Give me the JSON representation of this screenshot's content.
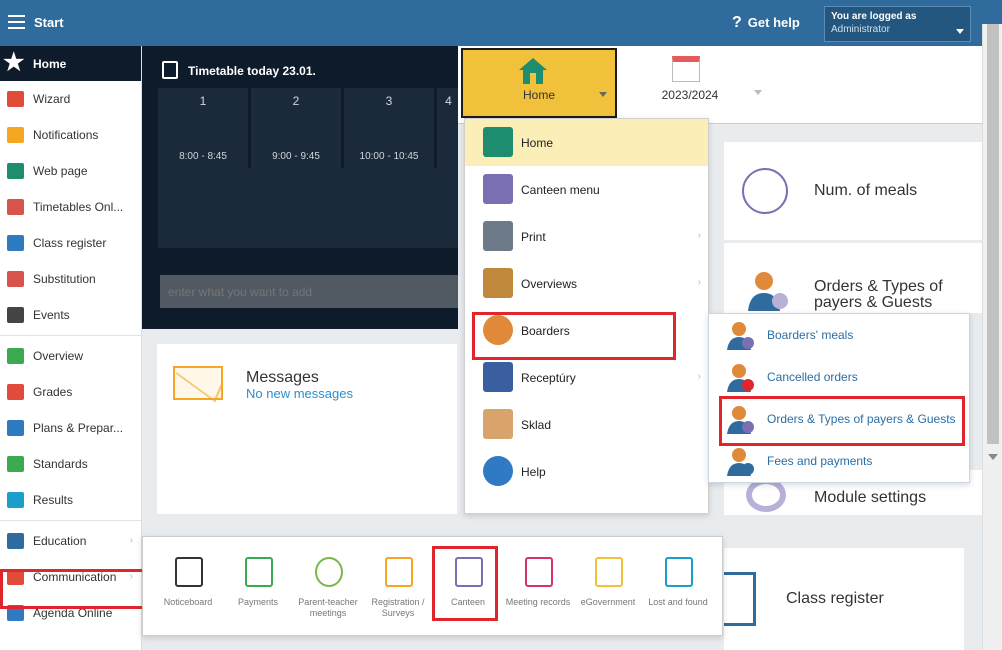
{
  "topbar": {
    "start_label": "Start",
    "help_label": "Get help",
    "login_line1": "You are logged as",
    "login_line2": "Administrator"
  },
  "sidebar": {
    "home_label": "Home",
    "items": [
      {
        "label": "Wizard",
        "icon": "wand-icon",
        "color": "#e04b3a"
      },
      {
        "label": "Notifications",
        "icon": "mail-icon",
        "color": "#f5a623"
      },
      {
        "label": "Web page",
        "icon": "house-icon",
        "color": "#1e8c6e"
      },
      {
        "label": "Timetables Onl...",
        "icon": "grid-icon",
        "color": "#d9534f"
      },
      {
        "label": "Class register",
        "icon": "book-icon",
        "color": "#2f7ac2"
      },
      {
        "label": "Substitution",
        "icon": "person-icon",
        "color": "#d9534f"
      },
      {
        "label": "Events",
        "icon": "calendar-icon",
        "color": "#444444"
      },
      {
        "label": "Overview",
        "icon": "check-icon",
        "color": "#3aaa4f"
      },
      {
        "label": "Grades",
        "icon": "badge-icon",
        "color": "#e04b3a"
      },
      {
        "label": "Plans & Prepar...",
        "icon": "briefcase-icon",
        "color": "#2f7ac2"
      },
      {
        "label": "Standards",
        "icon": "shield-icon",
        "color": "#3aaa4f"
      },
      {
        "label": "Results",
        "icon": "bar-chart-icon",
        "color": "#1aa0c8"
      },
      {
        "label": "Education",
        "icon": "books-icon",
        "color": "#2f6b9d"
      },
      {
        "label": "Communication",
        "icon": "chat-icon",
        "color": "#e04b3a"
      },
      {
        "label": "Agenda Online",
        "icon": "pencil-icon",
        "color": "#2f7ac2"
      }
    ]
  },
  "timetable": {
    "title": "Timetable today 23.01.",
    "columns": [
      {
        "num": "1",
        "time": "8:00 - 8:45"
      },
      {
        "num": "2",
        "time": "9:00 - 9:45"
      },
      {
        "num": "3",
        "time": "10:00 - 10:45"
      },
      {
        "num": "4",
        "time": ""
      }
    ],
    "input_placeholder": "enter what you want to add"
  },
  "messages": {
    "title": "Messages",
    "subtitle": "No new messages"
  },
  "toolbar": {
    "home_label": "Home",
    "year_label": "2023/2024"
  },
  "dropmenu": {
    "items": [
      {
        "label": "Home",
        "icon": "house-icon",
        "color": "#1e8c6e"
      },
      {
        "label": "Canteen menu",
        "icon": "cutlery-icon",
        "color": "#7b6fb3"
      },
      {
        "label": "Print",
        "icon": "printer-icon",
        "color": "#6c7a89"
      },
      {
        "label": "Overviews",
        "icon": "abacus-icon",
        "color": "#c0883a"
      },
      {
        "label": "Boarders",
        "icon": "person-icon",
        "color": "#e0893a"
      },
      {
        "label": "Receptúry",
        "icon": "recipe-book-icon",
        "color": "#3a5fa0"
      },
      {
        "label": "Sklad",
        "icon": "warehouse-cart-icon",
        "color": "#d9a46b"
      },
      {
        "label": "Help",
        "icon": "question-icon",
        "color": "#2f7ac2"
      }
    ]
  },
  "submenu": {
    "items": [
      {
        "label": "Boarders' meals",
        "icon": "person-cutlery-icon"
      },
      {
        "label": "Cancelled orders",
        "icon": "person-cancel-icon"
      },
      {
        "label": "Orders & Types of payers & Guests",
        "icon": "person-gear-icon"
      },
      {
        "label": "Fees and payments",
        "icon": "person-euro-icon"
      }
    ]
  },
  "cards": {
    "meals": "Num. of meals",
    "orders_line1": "Orders & Types of",
    "orders_line2": "payers & Guests",
    "module": "Module settings",
    "classreg": "Class register"
  },
  "communication": {
    "items": [
      {
        "label": "Noticeboard",
        "icon": "easel-icon",
        "color": "#333333"
      },
      {
        "label": "Payments",
        "icon": "money-icon",
        "color": "#3aaa4f"
      },
      {
        "label": "Parent-teacher meetings",
        "icon": "clock-icon",
        "color": "#7ab648"
      },
      {
        "label": "Registration / Surveys",
        "icon": "clipboard-icon",
        "color": "#f5a623"
      },
      {
        "label": "Canteen",
        "icon": "cutlery-icon",
        "color": "#7b6fb3"
      },
      {
        "label": "Meeting records",
        "icon": "document-icon",
        "color": "#d6336c"
      },
      {
        "label": "eGovernment",
        "icon": "government-icon",
        "color": "#f2c13c"
      },
      {
        "label": "Lost and found",
        "icon": "paper-plane-icon",
        "color": "#1aa0c8"
      }
    ]
  }
}
